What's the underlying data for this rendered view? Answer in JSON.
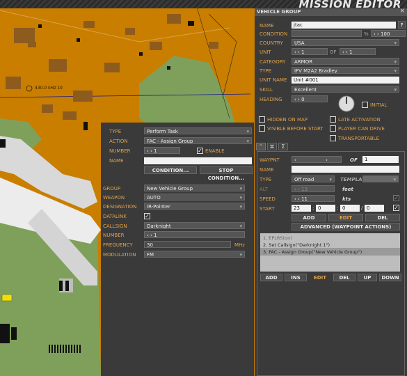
{
  "title": "MISSION EDITOR",
  "map": {
    "scale_label": "430.0 kHz 10"
  },
  "vehicle_group": {
    "header": "VEHICLE GROUP",
    "close": "×",
    "name_label": "NAME",
    "name_value": "jtac",
    "help": "?",
    "condition_label": "CONDITION",
    "condition_pct": "%",
    "condition_value": "100",
    "country_label": "COUNTRY",
    "country_value": "USA",
    "unit_label": "UNIT",
    "unit_value": "1",
    "unit_of": "OF",
    "unit_of_value": "1",
    "category_label": "CATEGORY",
    "category_value": "ARMOR",
    "type_label": "TYPE",
    "type_value": "IFV M2A2 Bradley",
    "unit_name_label": "UNIT NAME",
    "unit_name_value": "Unit #001",
    "skill_label": "SKILL",
    "skill_value": "Excellent",
    "heading_label": "HEADING",
    "heading_value": "0",
    "initial_label": "INITIAL",
    "hidden_on_map": "HIDDEN ON MAP",
    "late_activation": "LATE ACTIVATION",
    "visible_before_start": "VISIBLE BEFORE START",
    "player_can_drive": "PLAYER CAN DRIVE",
    "transportable": "TRANSPORTABLE",
    "tabs": [
      "^",
      "⌘",
      "Σ"
    ],
    "waypnt_label": "WAYPNT",
    "waypnt_of": "OF",
    "waypnt_of_value": "1",
    "wp_name_label": "NAME",
    "wp_type_label": "TYPE",
    "wp_type_value": "Off road",
    "templ_label": "TEMPLA",
    "alt_label": "ALT",
    "alt_value": "13",
    "alt_unit": "feet",
    "speed_label": "SPEED",
    "speed_value": "11",
    "speed_unit": "kts",
    "start_label": "START",
    "start_h": "23",
    "start_m": "0",
    "start_s": "0",
    "start_d": "0",
    "add": "ADD",
    "edit": "EDIT",
    "del": "DEL",
    "advanced": "ADVANCED (WAYPOINT ACTIONS)",
    "actions": [
      "1. EPLRS(on)",
      "2. Set Callsign(\"Darknight 1\")",
      "3. FAC - Assign Group(\"New Vehicle Group\")"
    ],
    "bottom_buttons": [
      "ADD",
      "INS",
      "EDIT",
      "DEL",
      "UP",
      "DOWN"
    ]
  },
  "action_panel": {
    "type_label": "TYPE",
    "type_value": "Perform Task",
    "action_label": "ACTION",
    "action_value": "FAC - Assign Group",
    "number_label": "NUMBER",
    "number_value": "1",
    "enable_label": "ENABLE",
    "name_label": "NAME",
    "condition_btn": "CONDITION...",
    "stop_condition_btn": "STOP CONDITION...",
    "group_label": "GROUP",
    "group_value": "New Vehicle Group",
    "weapon_label": "WEAPON",
    "weapon_value": "AUTO",
    "designation_label": "DESIGNATION",
    "designation_value": "IR-Pointer",
    "datalink_label": "DATALINK",
    "callsign_label": "CALLSIGN",
    "callsign_value": "Darknight",
    "number2_label": "NUMBER",
    "number2_value": "1",
    "frequency_label": "FREQUENCY",
    "frequency_value": "30",
    "frequency_unit": "MHz",
    "modulation_label": "MODULATION",
    "modulation_value": "FM"
  }
}
